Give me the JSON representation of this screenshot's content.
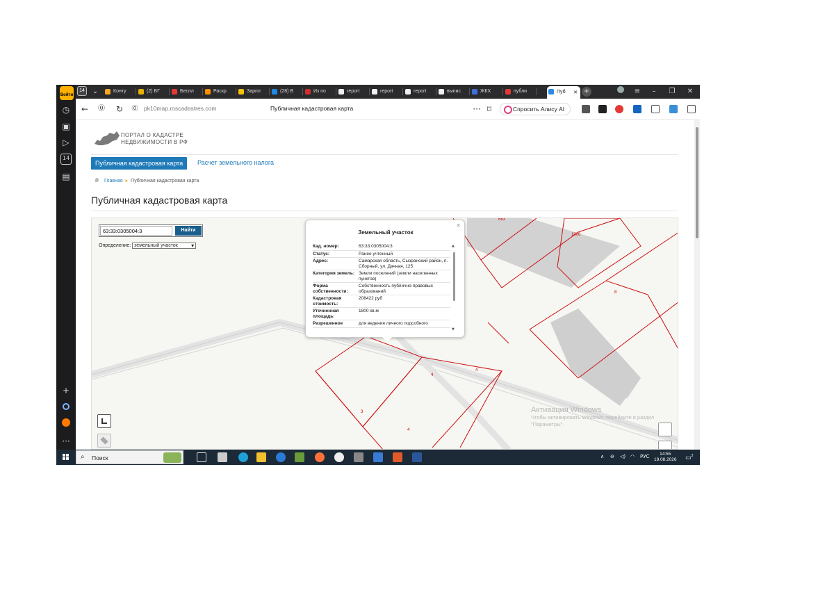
{
  "browser": {
    "tab_count": "14",
    "tabs": [
      {
        "label": "Конту",
        "color": "#f5a623"
      },
      {
        "label": "(2) БГ",
        "color": "#e8b100"
      },
      {
        "label": "Беспл",
        "color": "#e53935"
      },
      {
        "label": "Раскр",
        "color": "#ff8f00"
      },
      {
        "label": "Зарпл",
        "color": "#f4c20d"
      },
      {
        "label": "(28) В",
        "color": "#1e88e5"
      },
      {
        "label": "Из по",
        "color": "#d32f2f"
      },
      {
        "label": "report",
        "color": "#f0f0f0"
      },
      {
        "label": "report",
        "color": "#f0f0f0"
      },
      {
        "label": "report",
        "color": "#f0f0f0"
      },
      {
        "label": "выпис",
        "color": "#f0f0f0"
      },
      {
        "label": "ЖКХ",
        "color": "#3f6fd8"
      },
      {
        "label": "публи",
        "color": "#e53935"
      }
    ],
    "active_tab": {
      "label": "Пуб",
      "color": "#2a8be0"
    },
    "url": "pk10map.roscadastres.com",
    "page_title": "Публичная кадастровая карта",
    "alice_label": "Спросить Алису AI",
    "sidebar_badge": "14",
    "avatar_text": "Войти"
  },
  "site": {
    "portal_name_line1": "ПОРТАЛ О КАДАСТРЕ",
    "portal_name_line2": "НЕДВИЖИМОСТИ В РФ",
    "nav_map": "Публичная кадастровая карта",
    "nav_tax": "Расчет земельного налога",
    "breadcrumb_home": "Главная",
    "breadcrumb_current": "Публичная кадастровая карта",
    "heading": "Публичная кадастровая карта"
  },
  "map": {
    "search_value": "63:33:0305004:3",
    "search_button": "Найти",
    "definition_label": "Определение:",
    "definition_value": "земельный участок",
    "labels": {
      "l683": "683",
      "l1006": "1006",
      "l8": "8",
      "l4a": "4",
      "l4b": "4",
      "l4c": "4",
      "l3": "3"
    },
    "activation_title": "Активация Windows",
    "activation_text1": "Чтобы активировать Windows, перейдите в раздел",
    "activation_text2": "\"Параметры\"."
  },
  "popup": {
    "title": "Земельный участок",
    "rows": [
      {
        "key": "Кад. номер:",
        "value": "63:33:0305004:3"
      },
      {
        "key": "Статус:",
        "value": "Ранее учтенный"
      },
      {
        "key": "Адрес:",
        "value": "Самарская область, Сызранский район, п. Сборный, ул. Дачная, 125"
      },
      {
        "key": "Категория земель:",
        "value": "Земли поселений (земли населенных пунктов)"
      },
      {
        "key": "Форма собственности:",
        "value": "Собственность публично-правовых образований"
      },
      {
        "key": "Кадастровая стоимость:",
        "value": "208422 руб"
      },
      {
        "key": "Уточненная площадь:",
        "value": "1800 кв.м"
      },
      {
        "key": "Разрешенное",
        "value": "для ведения личного подсобного"
      }
    ]
  },
  "taskbar": {
    "search_placeholder": "Поиск",
    "lang": "РУС",
    "time": "14:55",
    "date": "19.08.2026",
    "notification_count": "2"
  }
}
